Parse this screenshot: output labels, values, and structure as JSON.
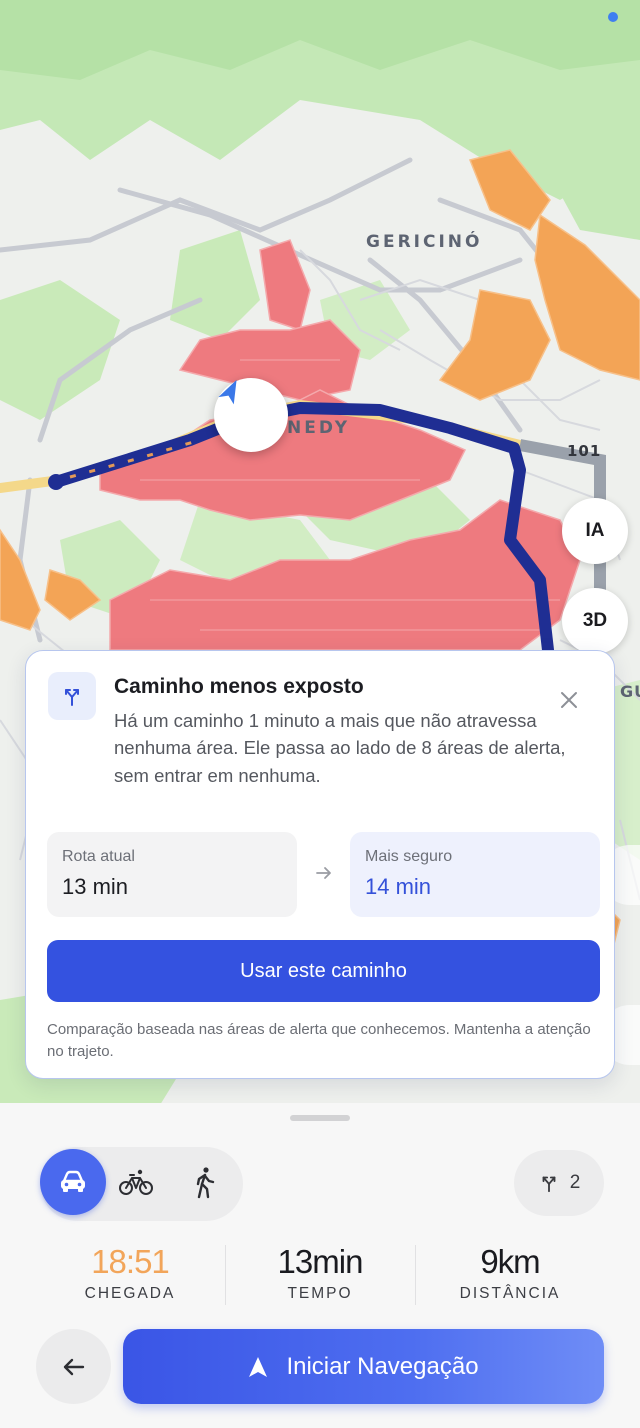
{
  "map": {
    "labels": {
      "neighborhood_1": "GERICINÓ",
      "neighborhood_2": "NEDY",
      "road_number": "101",
      "edge_label": "GU"
    },
    "buttons": {
      "ai": "IA",
      "three_d": "3D"
    },
    "colors": {
      "high_risk_area": "#ee7a7f",
      "medium_risk_area": "#f3a456",
      "route": "#23339a",
      "park": "#bfe6b0"
    }
  },
  "suggestion": {
    "icon": "route-split-icon",
    "title": "Caminho menos exposto",
    "description": "Há um caminho 1 minuto a mais que não atravessa nenhuma área. Ele passa ao lado de 8 áreas de alerta, sem entrar em nenhuma.",
    "current": {
      "label": "Rota atual",
      "value": "13 min"
    },
    "safer": {
      "label": "Mais seguro",
      "value": "14 min"
    },
    "button": "Usar este caminho",
    "footnote": "Comparação baseada nas áreas de alerta que conhecemos. Mantenha a atenção no trajeto."
  },
  "sheet": {
    "modes": [
      {
        "name": "car",
        "icon": "car-icon",
        "selected": true
      },
      {
        "name": "bike",
        "icon": "bicycle-icon",
        "selected": false
      },
      {
        "name": "walk",
        "icon": "walking-icon",
        "selected": false
      }
    ],
    "routes_count": "2",
    "stats": {
      "arrival": {
        "value": "18:51",
        "label": "CHEGADA"
      },
      "time": {
        "value": "13min",
        "label": "TEMPO"
      },
      "distance": {
        "value": "9km",
        "label": "DISTÂNCIA"
      }
    },
    "start_button": "Iniciar Navegação",
    "accent": "#3a55e6"
  }
}
